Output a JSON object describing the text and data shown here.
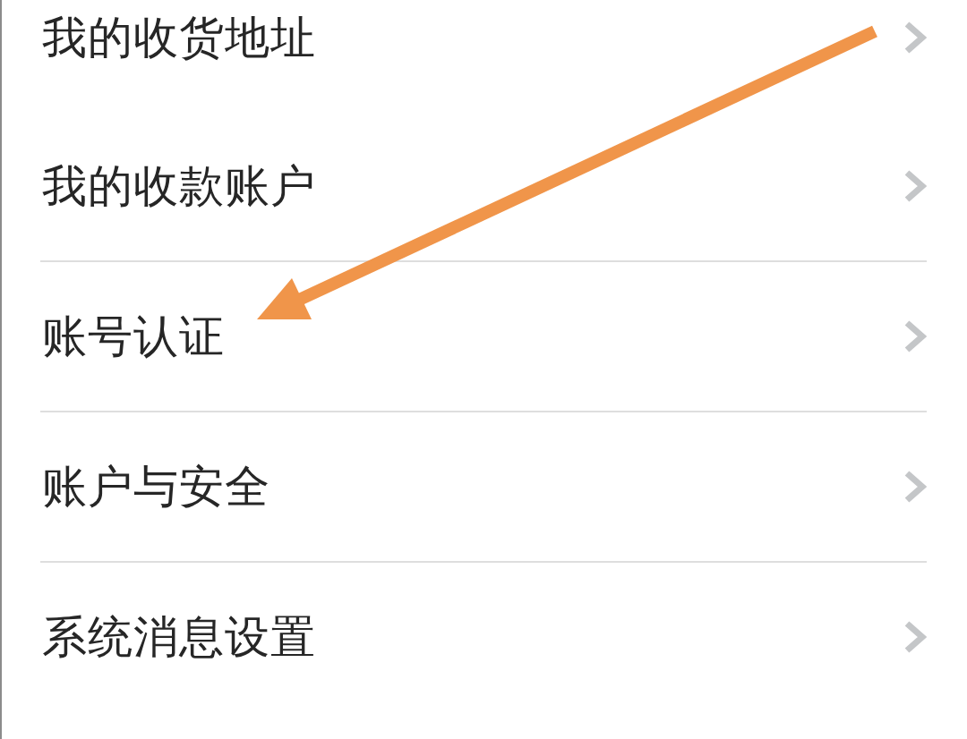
{
  "sections": [
    {
      "items": [
        {
          "label": "我的收货地址"
        },
        {
          "label": "我的收款账户"
        }
      ]
    },
    {
      "items": [
        {
          "label": "账号认证"
        }
      ]
    },
    {
      "items": [
        {
          "label": "账户与安全"
        }
      ]
    },
    {
      "items": [
        {
          "label": "系统消息设置"
        }
      ]
    }
  ]
}
